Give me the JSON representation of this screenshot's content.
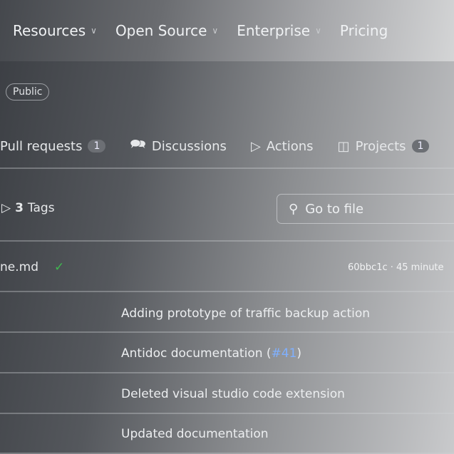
{
  "nav": {
    "items": [
      {
        "label": "Resources",
        "dropdown": true
      },
      {
        "label": "Open Source",
        "dropdown": true
      },
      {
        "label": "Enterprise",
        "dropdown": true
      },
      {
        "label": "Pricing",
        "dropdown": false
      }
    ]
  },
  "repo": {
    "visibility": "Public"
  },
  "tabs": [
    {
      "label": "Pull requests",
      "count": "1",
      "icon": "pull-request-icon"
    },
    {
      "label": "Discussions",
      "icon": "discussions-icon"
    },
    {
      "label": "Actions",
      "icon": "play-icon"
    },
    {
      "label": "Projects",
      "count": "1",
      "icon": "table-icon"
    }
  ],
  "tags": {
    "count": "3",
    "label": "Tags"
  },
  "search": {
    "placeholder": "Go to file"
  },
  "latest_commit": {
    "file": "ne.md",
    "status": "success",
    "hash_time": "60bbc1c · 45 minute"
  },
  "commits": [
    {
      "message": "Adding prototype of traffic backup action"
    },
    {
      "message": "Antidoc documentation (",
      "link": "#41",
      "suffix": ")"
    },
    {
      "message": "Deleted visual studio code extension"
    },
    {
      "message": "Updated documentation"
    }
  ],
  "colors": {
    "check": "#3fb950",
    "link": "#7fb0ff"
  }
}
